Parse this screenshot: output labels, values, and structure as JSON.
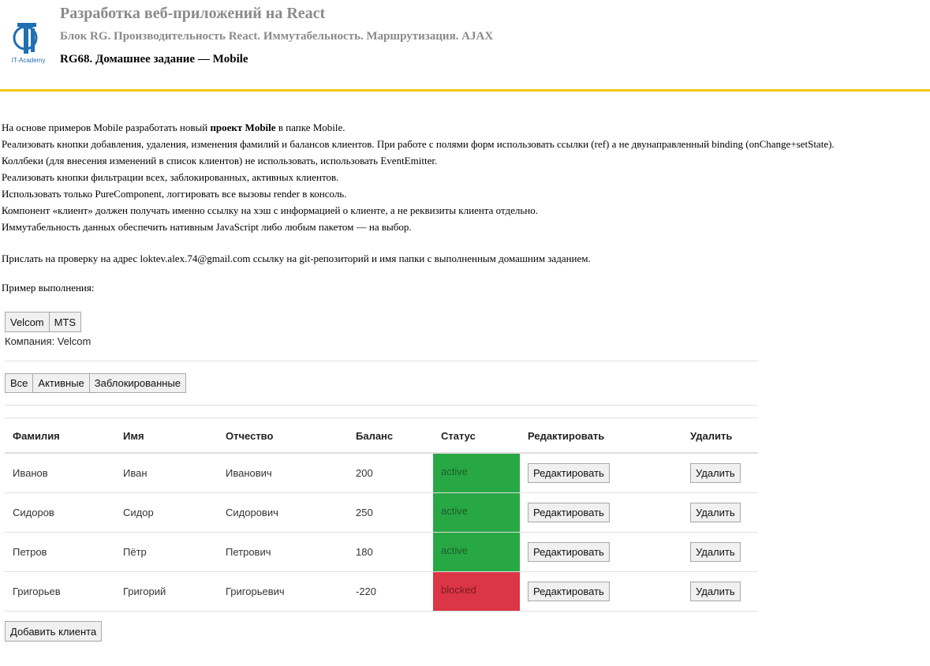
{
  "header": {
    "logo_text": "IT-Academy",
    "course": "Разработка веб-приложений на React",
    "block": "Блок RG. Производительность React. Иммутабельность. Маршрутизация. AJAX",
    "task": "RG68. Домашнее задание — Mobile",
    "accent_color": "#f2c811"
  },
  "description": {
    "line1_prefix": "На основе примеров Mobile разработать новый ",
    "line1_bold": "проект Mobile",
    "line1_suffix": " в папке Mobile.",
    "line2": "Реализовать кнопки добавления, удаления, изменения фамилий и балансов клиентов. При работе с полями форм использовать ссылки (ref) а не двунаправленный binding (onChange+setState).",
    "line3": "Коллбеки (для внесения изменений в список клиентов) не использовать, использовать EventEmitter.",
    "line4": "Реализовать кнопки фильтрации всех, заблокированных, активных клиентов.",
    "line5": "Использовать только PureComponent, логгировать все вызовы render в консоль.",
    "line6": "Компонент «клиент» должен получать именно ссылку на хэш с информацией о клиенте, а не реквизиты клиента отдельно.",
    "line7": "Иммутабельность данных обеспечить нативным JavaScript либо любым пакетом — на выбор.",
    "send": "Прислать на проверку на адрес loktev.alex.74@gmail.com ссылку на git-репозиторий и имя папки с выполненным домашним заданием.",
    "example": "Пример выполнения:"
  },
  "companies": {
    "buttons": [
      "Velcom",
      "MTS"
    ],
    "label": "Компания: Velcom"
  },
  "filters": [
    "Все",
    "Активные",
    "Заблокированные"
  ],
  "table": {
    "headers": [
      "Фамилия",
      "Имя",
      "Отчество",
      "Баланс",
      "Статус",
      "Редактировать",
      "Удалить"
    ],
    "rows": [
      {
        "last": "Иванов",
        "first": "Иван",
        "middle": "Иванович",
        "balance": "200",
        "status": "active",
        "edit": "Редактировать",
        "delete": "Удалить"
      },
      {
        "last": "Сидоров",
        "first": "Сидор",
        "middle": "Сидорович",
        "balance": "250",
        "status": "active",
        "edit": "Редактировать",
        "delete": "Удалить"
      },
      {
        "last": "Петров",
        "first": "Пётр",
        "middle": "Петрович",
        "balance": "180",
        "status": "active",
        "edit": "Редактировать",
        "delete": "Удалить"
      },
      {
        "last": "Григорьев",
        "first": "Григорий",
        "middle": "Григорьевич",
        "balance": "-220",
        "status": "blocked",
        "edit": "Редактировать",
        "delete": "Удалить"
      }
    ],
    "status_colors": {
      "active": "#28a745",
      "blocked": "#dc3545"
    }
  },
  "add_button": "Добавить клиента"
}
